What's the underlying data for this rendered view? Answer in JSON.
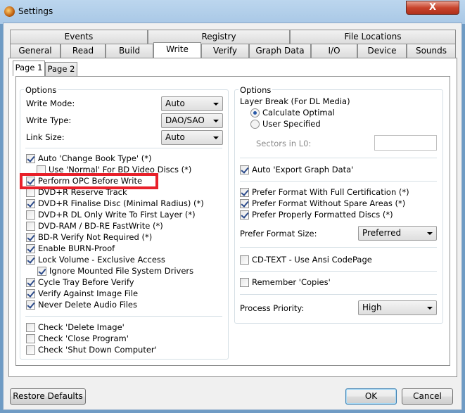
{
  "window": {
    "title": "Settings",
    "close_label": "X"
  },
  "tabs_row1": [
    "Events",
    "Registry",
    "File Locations"
  ],
  "tabs_row2": [
    "General",
    "Read",
    "Build",
    "Write",
    "Verify",
    "Graph Data",
    "I/O",
    "Device",
    "Sounds"
  ],
  "active_tab": "Write",
  "subtabs": [
    "Page 1",
    "Page 2"
  ],
  "left": {
    "title": "Options",
    "write_mode": {
      "label": "Write Mode:",
      "value": "Auto"
    },
    "write_type": {
      "label": "Write Type:",
      "value": "DAO/SAO"
    },
    "link_size": {
      "label": "Link Size:",
      "value": "Auto"
    },
    "checks": [
      {
        "label": "Auto 'Change Book Type' (*)",
        "checked": true
      },
      {
        "label": "Use 'Normal' For BD Video Discs (*)",
        "checked": false
      },
      {
        "label": "Perform OPC Before Write",
        "checked": true
      },
      {
        "label": "DVD+R Reserve Track",
        "checked": false
      },
      {
        "label": "DVD+R Finalise Disc (Minimal Radius) (*)",
        "checked": true
      },
      {
        "label": "DVD+R DL Only Write To First Layer (*)",
        "checked": false
      },
      {
        "label": "DVD-RAM / BD-RE FastWrite (*)",
        "checked": false
      },
      {
        "label": "BD-R Verify Not Required (*)",
        "checked": true
      },
      {
        "label": "Enable BURN-Proof",
        "checked": true
      },
      {
        "label": "Lock Volume - Exclusive Access",
        "checked": true
      },
      {
        "label": "Ignore Mounted File System Drivers",
        "checked": true
      },
      {
        "label": "Cycle Tray Before Verify",
        "checked": true
      },
      {
        "label": "Verify Against Image File",
        "checked": true
      },
      {
        "label": "Never Delete Audio Files",
        "checked": true
      },
      {
        "label": "Check 'Delete Image'",
        "checked": false
      },
      {
        "label": "Check 'Close Program'",
        "checked": false
      },
      {
        "label": "Check 'Shut Down Computer'",
        "checked": false
      }
    ]
  },
  "right": {
    "title": "Options",
    "layer_break": "Layer Break (For DL Media)",
    "radio_calc": "Calculate Optimal",
    "radio_user": "User Specified",
    "sectors_label": "Sectors in L0:",
    "sectors_value": "",
    "auto_export": {
      "label": "Auto 'Export Graph Data'",
      "checked": true
    },
    "pref_full": {
      "label": "Prefer Format With Full Certification (*)",
      "checked": true
    },
    "pref_spare": {
      "label": "Prefer Format Without Spare Areas (*)",
      "checked": true
    },
    "pref_proper": {
      "label": "Prefer Properly Formatted Discs (*)",
      "checked": true
    },
    "format_size": {
      "label": "Prefer Format Size:",
      "value": "Preferred"
    },
    "cd_text": {
      "label": "CD-TEXT - Use Ansi CodePage",
      "checked": false
    },
    "remember": {
      "label": "Remember 'Copies'",
      "checked": false
    },
    "priority": {
      "label": "Process Priority:",
      "value": "High"
    }
  },
  "buttons": {
    "restore": "Restore Defaults",
    "ok": "OK",
    "cancel": "Cancel"
  }
}
